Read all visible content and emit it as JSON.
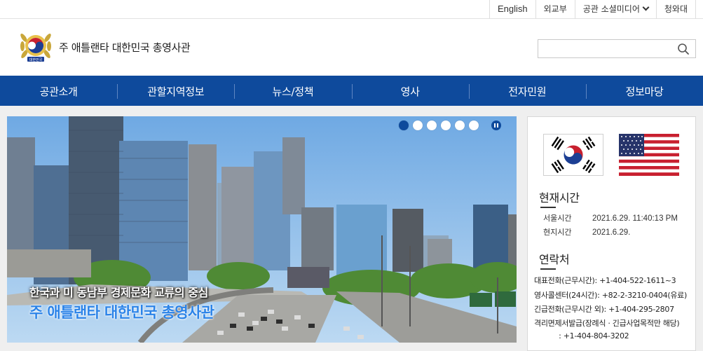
{
  "util_links": [
    "English",
    "외교부",
    "공관 소셜미디어",
    "청와대"
  ],
  "header": {
    "site_title": "주 애틀랜타 대한민국 총영사관",
    "emblem_text": "대한민국",
    "search_placeholder": ""
  },
  "gnb": [
    "공관소개",
    "관할지역정보",
    "뉴스/정책",
    "영사",
    "전자민원",
    "정보마당"
  ],
  "banner": {
    "subtitle": "한국과 미 동남부 경제문화 교류의 중심",
    "title": "주 애틀랜타 대한민국 총영사관",
    "slide_count": 6,
    "active_slide": 1
  },
  "info": {
    "time_title": "현재시간",
    "seoul_label": "서울시간",
    "seoul_value": "2021.6.29.  11:40:13 PM",
    "local_label": "현지시간",
    "local_value": "2021.6.29.",
    "contact_title": "연락처",
    "contacts": [
      "대표전화(근무시간): +1-404-522-1611~3",
      "영사콜센터(24시간): +82-2-3210-0404(유료)",
      "긴급전화(근무시간 외): +1-404-295-2807",
      "격리면제서발급(장례식 · 긴급사업목적만 해당)",
      "           : +1-404-804-3202"
    ]
  },
  "colors": {
    "primary": "#0e4a9c",
    "accent": "#2b83e8"
  }
}
